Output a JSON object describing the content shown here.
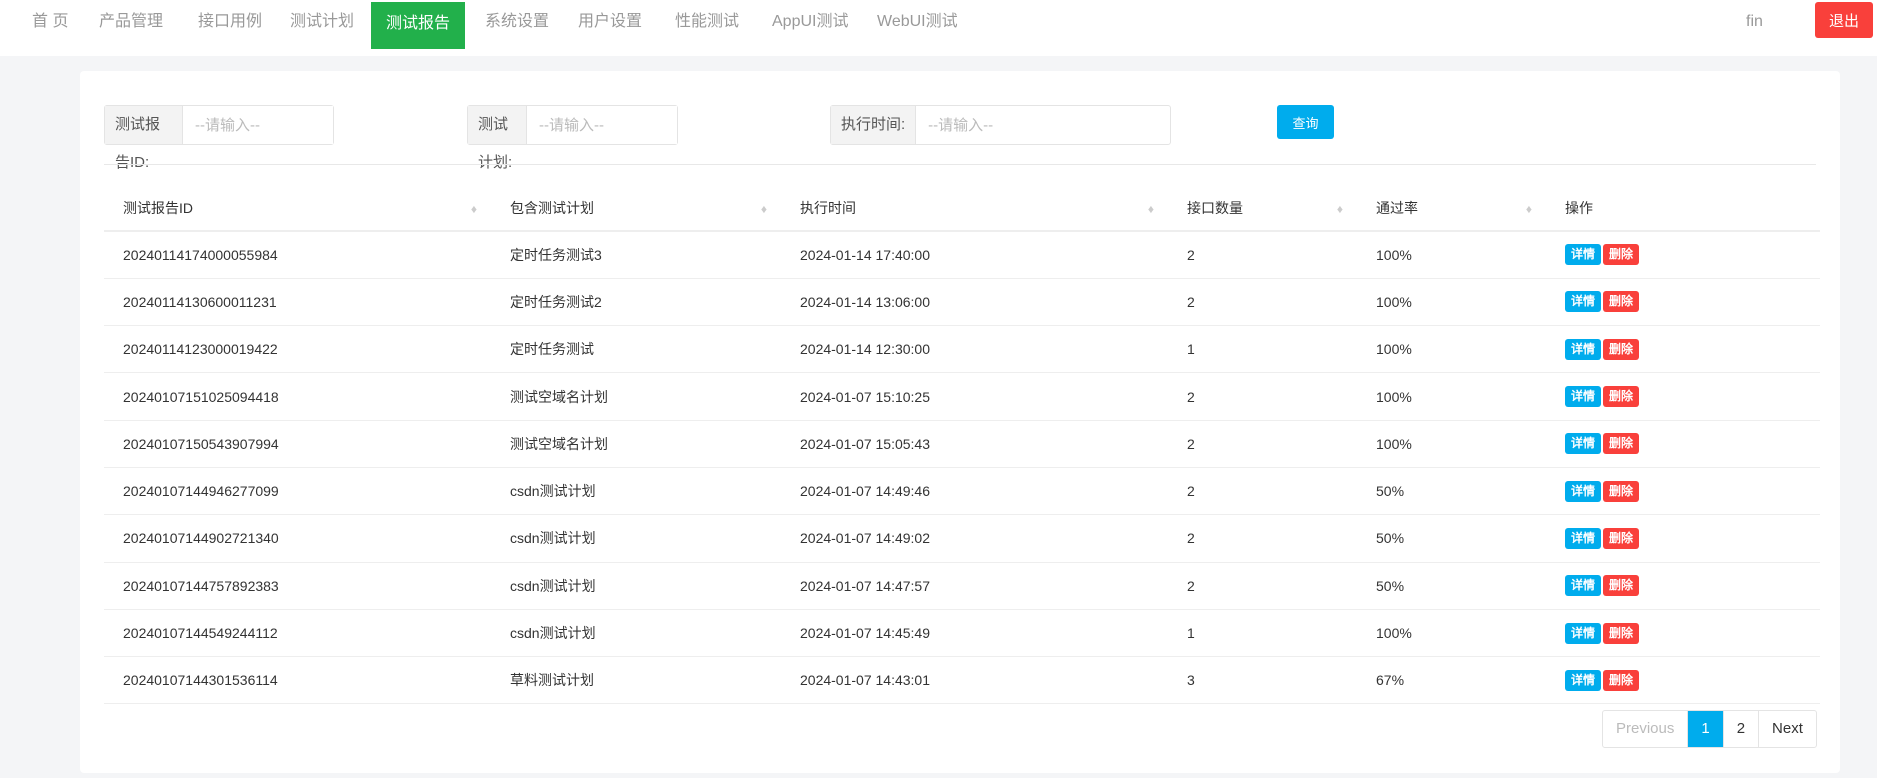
{
  "nav": {
    "items": [
      "首 页",
      "产品管理",
      "接口用例",
      "测试计划",
      "测试报告",
      "系统设置",
      "用户设置",
      "性能测试",
      "AppUI测试",
      "WebUI测试"
    ],
    "active": 4,
    "user": "fin",
    "logout": "退出"
  },
  "filters": [
    {
      "label": "测试报告ID:",
      "placeholder": "--请输入--"
    },
    {
      "label": "测试计划:",
      "placeholder": "--请输入--"
    },
    {
      "label": "执行时间:",
      "placeholder": "--请输入--"
    }
  ],
  "query_label": "查询",
  "table": {
    "headers": [
      "测试报告ID",
      "包含测试计划",
      "执行时间",
      "接口数量",
      "通过率",
      "操作"
    ],
    "rows": [
      [
        "20240114174000055984",
        "定时任务测试3",
        "2024-01-14 17:40:00",
        "2",
        "100%"
      ],
      [
        "20240114130600011231",
        "定时任务测试2",
        "2024-01-14 13:06:00",
        "2",
        "100%"
      ],
      [
        "20240114123000019422",
        "定时任务测试",
        "2024-01-14 12:30:00",
        "1",
        "100%"
      ],
      [
        "20240107151025094418",
        "测试空域名计划",
        "2024-01-07 15:10:25",
        "2",
        "100%"
      ],
      [
        "20240107150543907994",
        "测试空域名计划",
        "2024-01-07 15:05:43",
        "2",
        "100%"
      ],
      [
        "20240107144946277099",
        "csdn测试计划",
        "2024-01-07 14:49:46",
        "2",
        "50%"
      ],
      [
        "20240107144902721340",
        "csdn测试计划",
        "2024-01-07 14:49:02",
        "2",
        "50%"
      ],
      [
        "20240107144757892383",
        "csdn测试计划",
        "2024-01-07 14:47:57",
        "2",
        "50%"
      ],
      [
        "20240107144549244112",
        "csdn测试计划",
        "2024-01-07 14:45:49",
        "1",
        "100%"
      ],
      [
        "20240107144301536114",
        "草料测试计划",
        "2024-01-07 14:43:01",
        "3",
        "67%"
      ]
    ],
    "detail_label": "详情",
    "delete_label": "删除"
  },
  "pagination": {
    "previous": "Previous",
    "pages": [
      "1",
      "2"
    ],
    "current": "1",
    "next": "Next"
  }
}
